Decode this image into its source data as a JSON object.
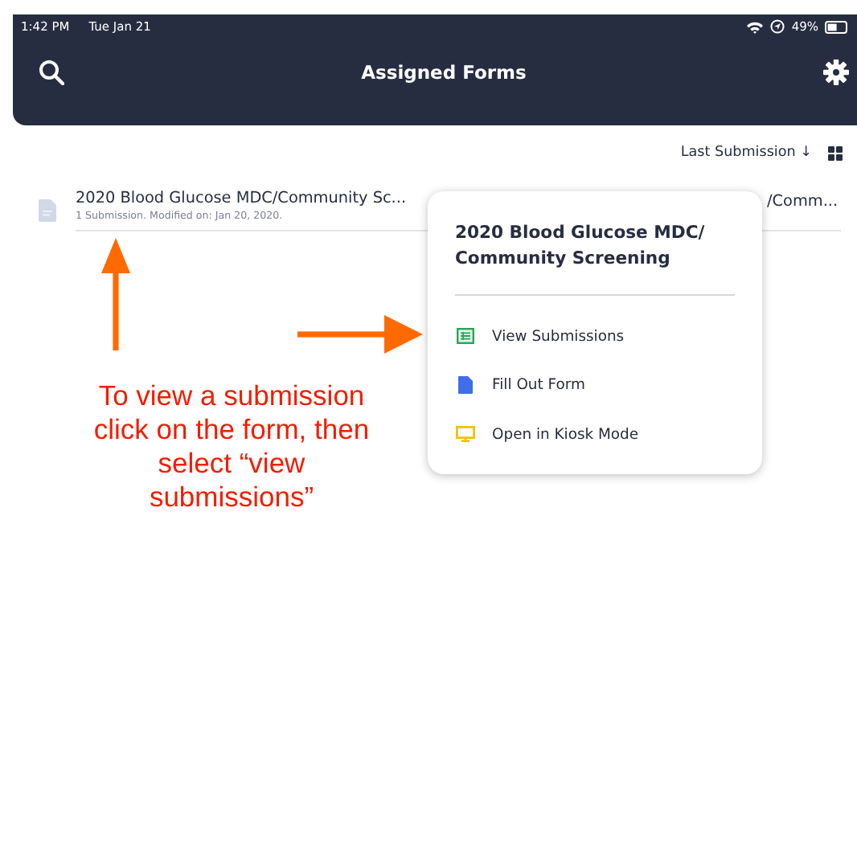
{
  "status_bar": {
    "time": "1:42 PM",
    "date": "Tue Jan 21",
    "battery": "49%"
  },
  "header": {
    "title": "Assigned Forms"
  },
  "sort": {
    "label": "Last Submission ↓"
  },
  "forms": [
    {
      "title": "2020 Blood Glucose MDC/Community Sc...",
      "meta": "1 Submission. Modified on: Jan 20, 2020."
    }
  ],
  "hidden_form_title": "/Comm...",
  "popup": {
    "title": "2020 Blood Glucose MDC/ Community Screening",
    "items": [
      {
        "kind": "table",
        "label": "View Submissions"
      },
      {
        "kind": "document",
        "label": "Fill Out Form"
      },
      {
        "kind": "monitor",
        "label": "Open in Kiosk Mode"
      }
    ]
  },
  "annotation": {
    "text": "To view a submission click on the form, then select “view submissions”"
  }
}
